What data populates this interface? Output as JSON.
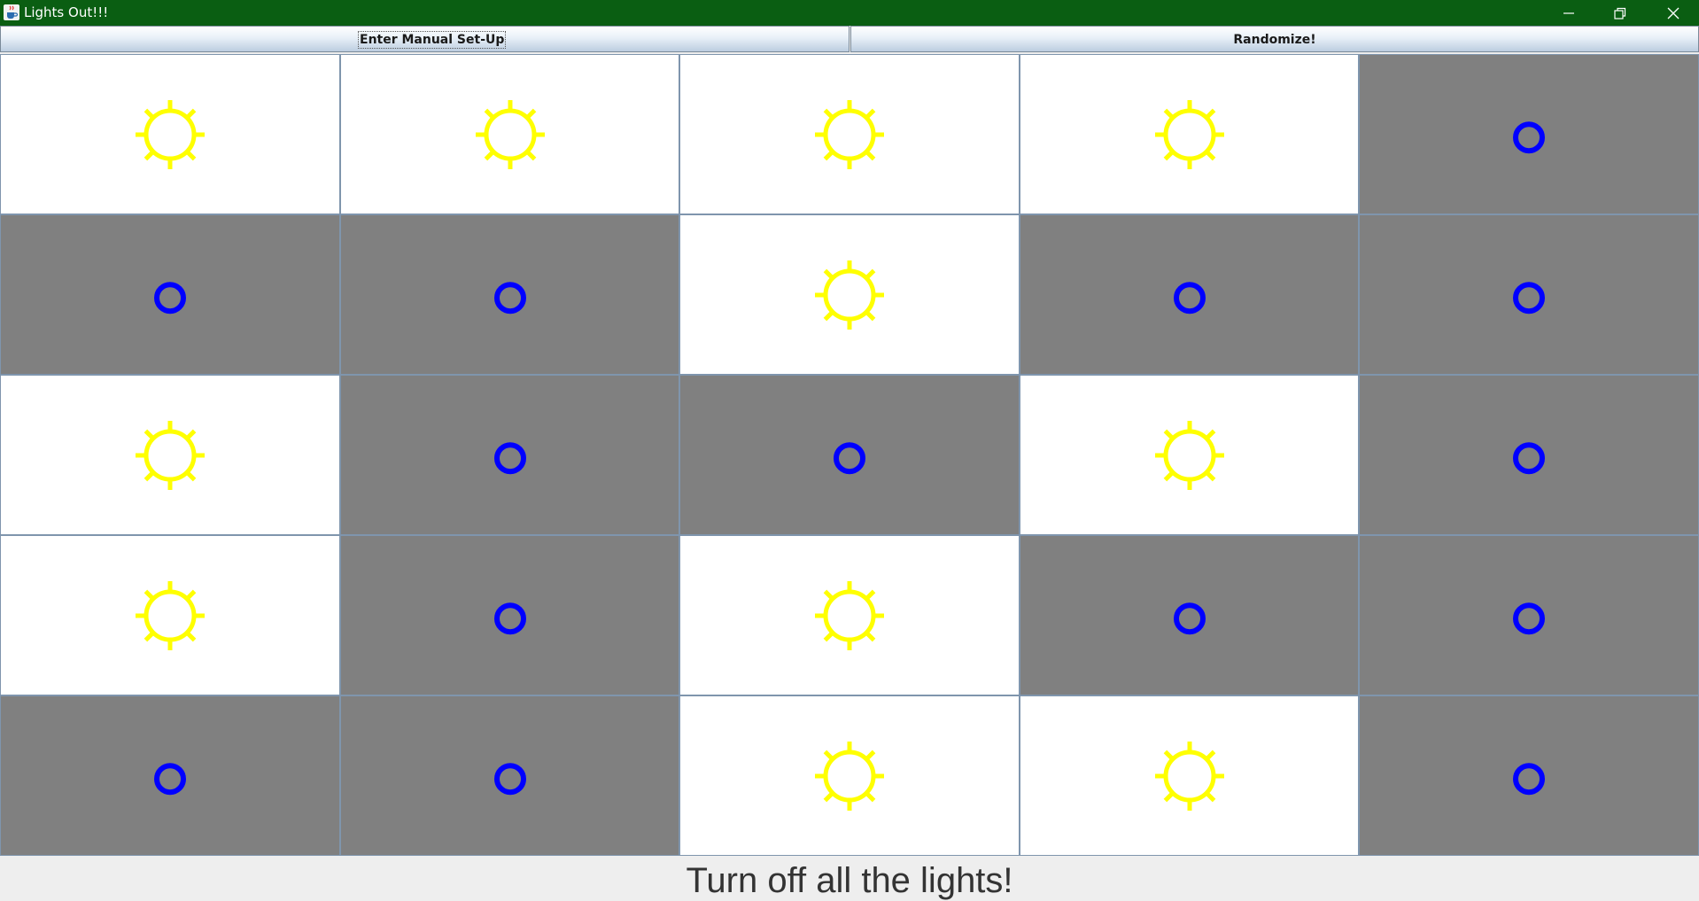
{
  "window": {
    "title": "Lights Out!!!",
    "titlebar_color": "#0a5e12",
    "icon": "java-cup-icon"
  },
  "toolbar": {
    "manual_label": "Enter Manual Set-Up",
    "randomize_label": "Randomize!"
  },
  "board": {
    "rows": 5,
    "cols": 5,
    "on_color": "#ffffff",
    "off_color": "#808080",
    "sun_color": "#ffff00",
    "ring_color": "#0000ff",
    "on_icon": "sun-icon",
    "off_icon": "circle-icon",
    "cells": [
      [
        true,
        true,
        true,
        true,
        false
      ],
      [
        false,
        false,
        true,
        false,
        false
      ],
      [
        true,
        false,
        false,
        true,
        false
      ],
      [
        true,
        false,
        true,
        false,
        false
      ],
      [
        false,
        false,
        true,
        true,
        false
      ]
    ]
  },
  "status": {
    "message": "Turn off all the lights!"
  }
}
